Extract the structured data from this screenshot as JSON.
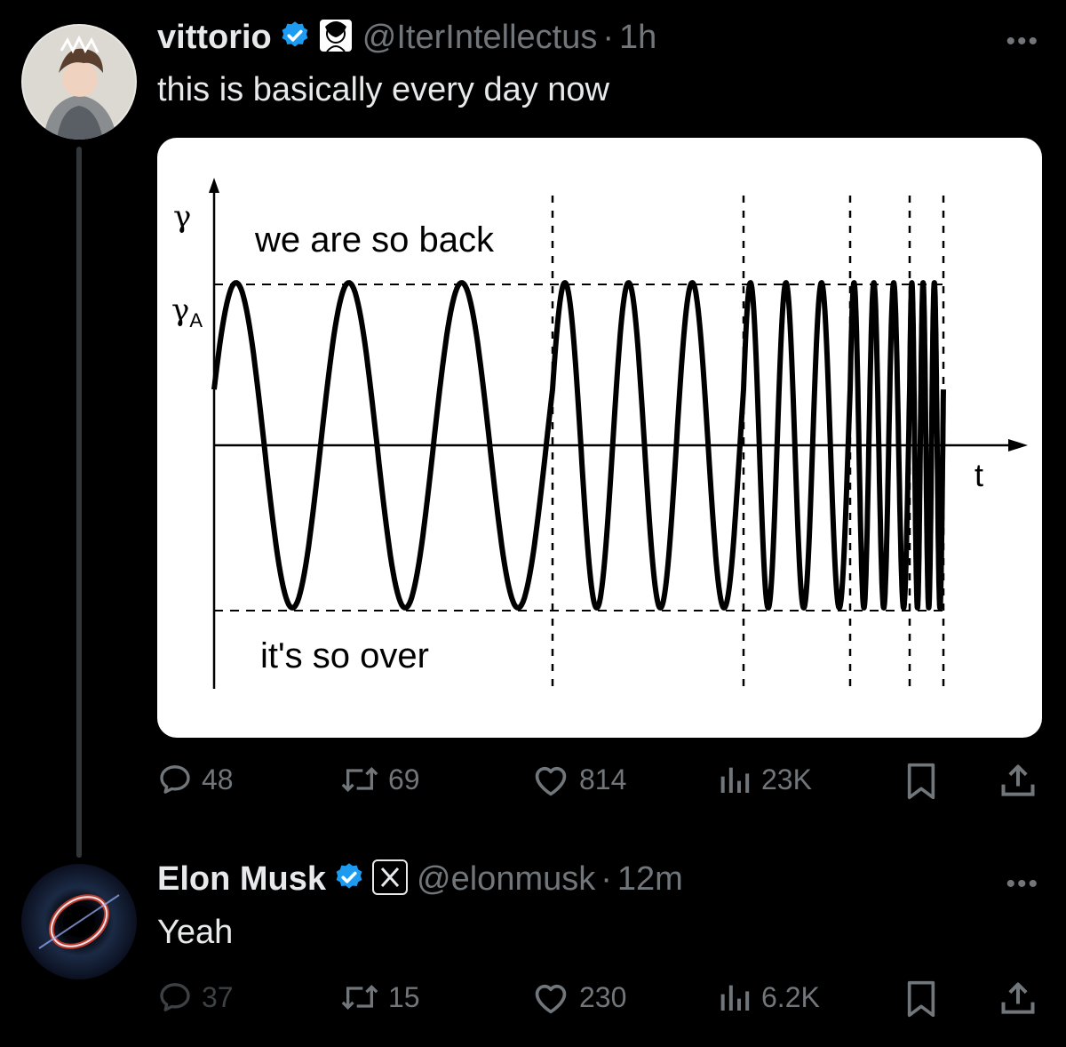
{
  "tweets": [
    {
      "name": "vittorio",
      "handle": "@IterIntellectus",
      "dot": "·",
      "time": "1h",
      "text": "this is basically every day now",
      "more": "•••",
      "chart_labels": {
        "y_symbol": "γ",
        "y_a_symbol": "γ",
        "y_a_sub": "A",
        "x_label": "t",
        "top_label": "we are so back",
        "bottom_label": "it's so over"
      },
      "stats": {
        "replies": "48",
        "reposts": "69",
        "likes": "814",
        "views": "23K"
      }
    },
    {
      "name": "Elon Musk",
      "handle": "@elonmusk",
      "dot": "·",
      "time": "12m",
      "text": "Yeah",
      "more": "•••",
      "stats": {
        "replies": "37",
        "reposts": "15",
        "likes": "230",
        "views": "6.2K"
      }
    }
  ],
  "colors": {
    "verified": "#1d9bf0",
    "muted": "#71767b",
    "text": "#e7e9ea",
    "thread_line": "#333639"
  },
  "icons": [
    "reply-icon",
    "repost-icon",
    "like-icon",
    "views-icon",
    "bookmark-icon",
    "share-icon",
    "verified-badge-icon",
    "affiliate-badge-icon"
  ]
}
